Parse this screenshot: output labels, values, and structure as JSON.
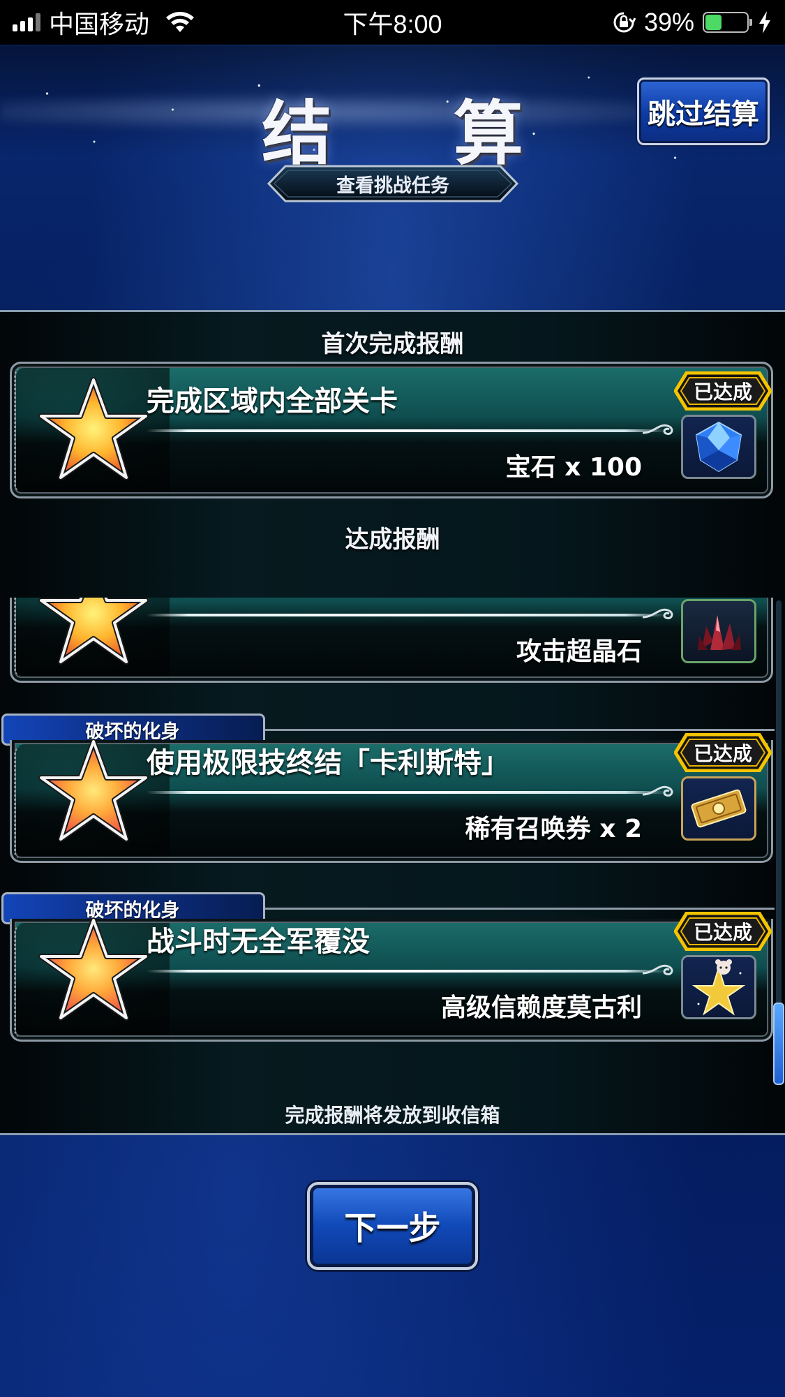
{
  "status_bar": {
    "carrier": "中国移动",
    "time": "下午8:00",
    "battery_percent": "39%",
    "battery_level": 0.39
  },
  "header": {
    "title": "结 算",
    "skip_button": "跳过结算",
    "challenge_button": "查看挑战任务"
  },
  "sections": {
    "first_clear": "首次完成报酬",
    "achievement": "达成报酬"
  },
  "first_clear_reward": {
    "mission": "完成区域内全部关卡",
    "reward": "宝石 x 100",
    "badge": "已达成",
    "item_icon": "blue-gem-icon"
  },
  "achievement_rewards": [
    {
      "group": "",
      "mission": "",
      "reward": "攻击超晶石",
      "badge": "",
      "item_icon": "red-crystal-icon"
    },
    {
      "group": "破坏的化身",
      "mission": "使用极限技终结「卡利斯特」",
      "reward": "稀有召唤券 x 2",
      "badge": "已达成",
      "item_icon": "summon-ticket-icon"
    },
    {
      "group": "破坏的化身",
      "mission": "战斗时无全军覆没",
      "reward": "高级信赖度莫古利",
      "badge": "已达成",
      "item_icon": "moogle-star-icon"
    }
  ],
  "footer_note": "完成报酬将发放到收信箱",
  "next_button": "下一步",
  "colors": {
    "badge_gold": "#f5c400",
    "card_teal": "#1c6f6c",
    "button_blue": "#1049b8"
  }
}
